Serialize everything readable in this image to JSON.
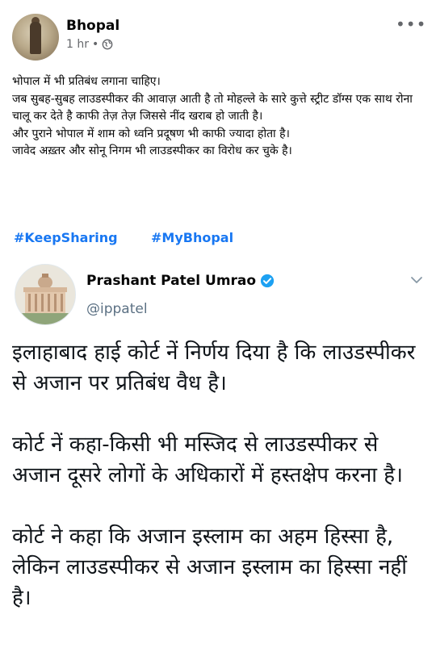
{
  "post": {
    "page_name": "Bhopal",
    "time": "1 hr",
    "separator": "•",
    "privacy_icon": "globe-icon",
    "more_icon": "more-dots-icon",
    "more_glyph": "•••",
    "body_lines": [
      "भोपाल में भी प्रतिबंध लगाना चाहिए।",
      "जब सुबह-सुबह लाउडस्पीकर की आवाज़ आती है तो मोहल्ले के सारे कुत्ते स्ट्रीट डॉग्स एक साथ रोना चालू कर देते है काफी तेज़ तेज़ जिससे नींद खराब हो जाती है।",
      "और पुराने भोपाल में शाम को ध्वनि प्रदूषण भी काफी ज्यादा होता है।",
      "जावेद अख़्तर और सोनू निगम भी लाउडस्पीकर का विरोध कर चुके है।"
    ],
    "hashtags": [
      "#KeepSharing",
      "#MyBhopal"
    ]
  },
  "tweet": {
    "name": "Prashant Patel Umrao",
    "handle": "@ippatel",
    "verified_icon": "verified-badge-icon",
    "chevron_icon": "chevron-down-icon",
    "paragraphs": [
      "इलाहाबाद हाई कोर्ट नें निर्णय दिया है कि लाउडस्पीकर से अजान पर प्रतिबंध वैध है।",
      "कोर्ट नें कहा-किसी भी मस्जिद से लाउडस्पीकर से अजान दूसरे लोगों के अधिकारों में हस्तक्षेप करना है।",
      "कोर्ट ने कहा कि अजान इस्लाम का अहम हिस्सा है, लेकिन लाउडस्पीकर से अजान इस्लाम का हिस्सा नहीं है।"
    ]
  },
  "colors": {
    "hashtag": "#1877f2",
    "verified": "#1da1f2",
    "meta_gray": "#65676b",
    "handle_gray": "#5b7083"
  }
}
